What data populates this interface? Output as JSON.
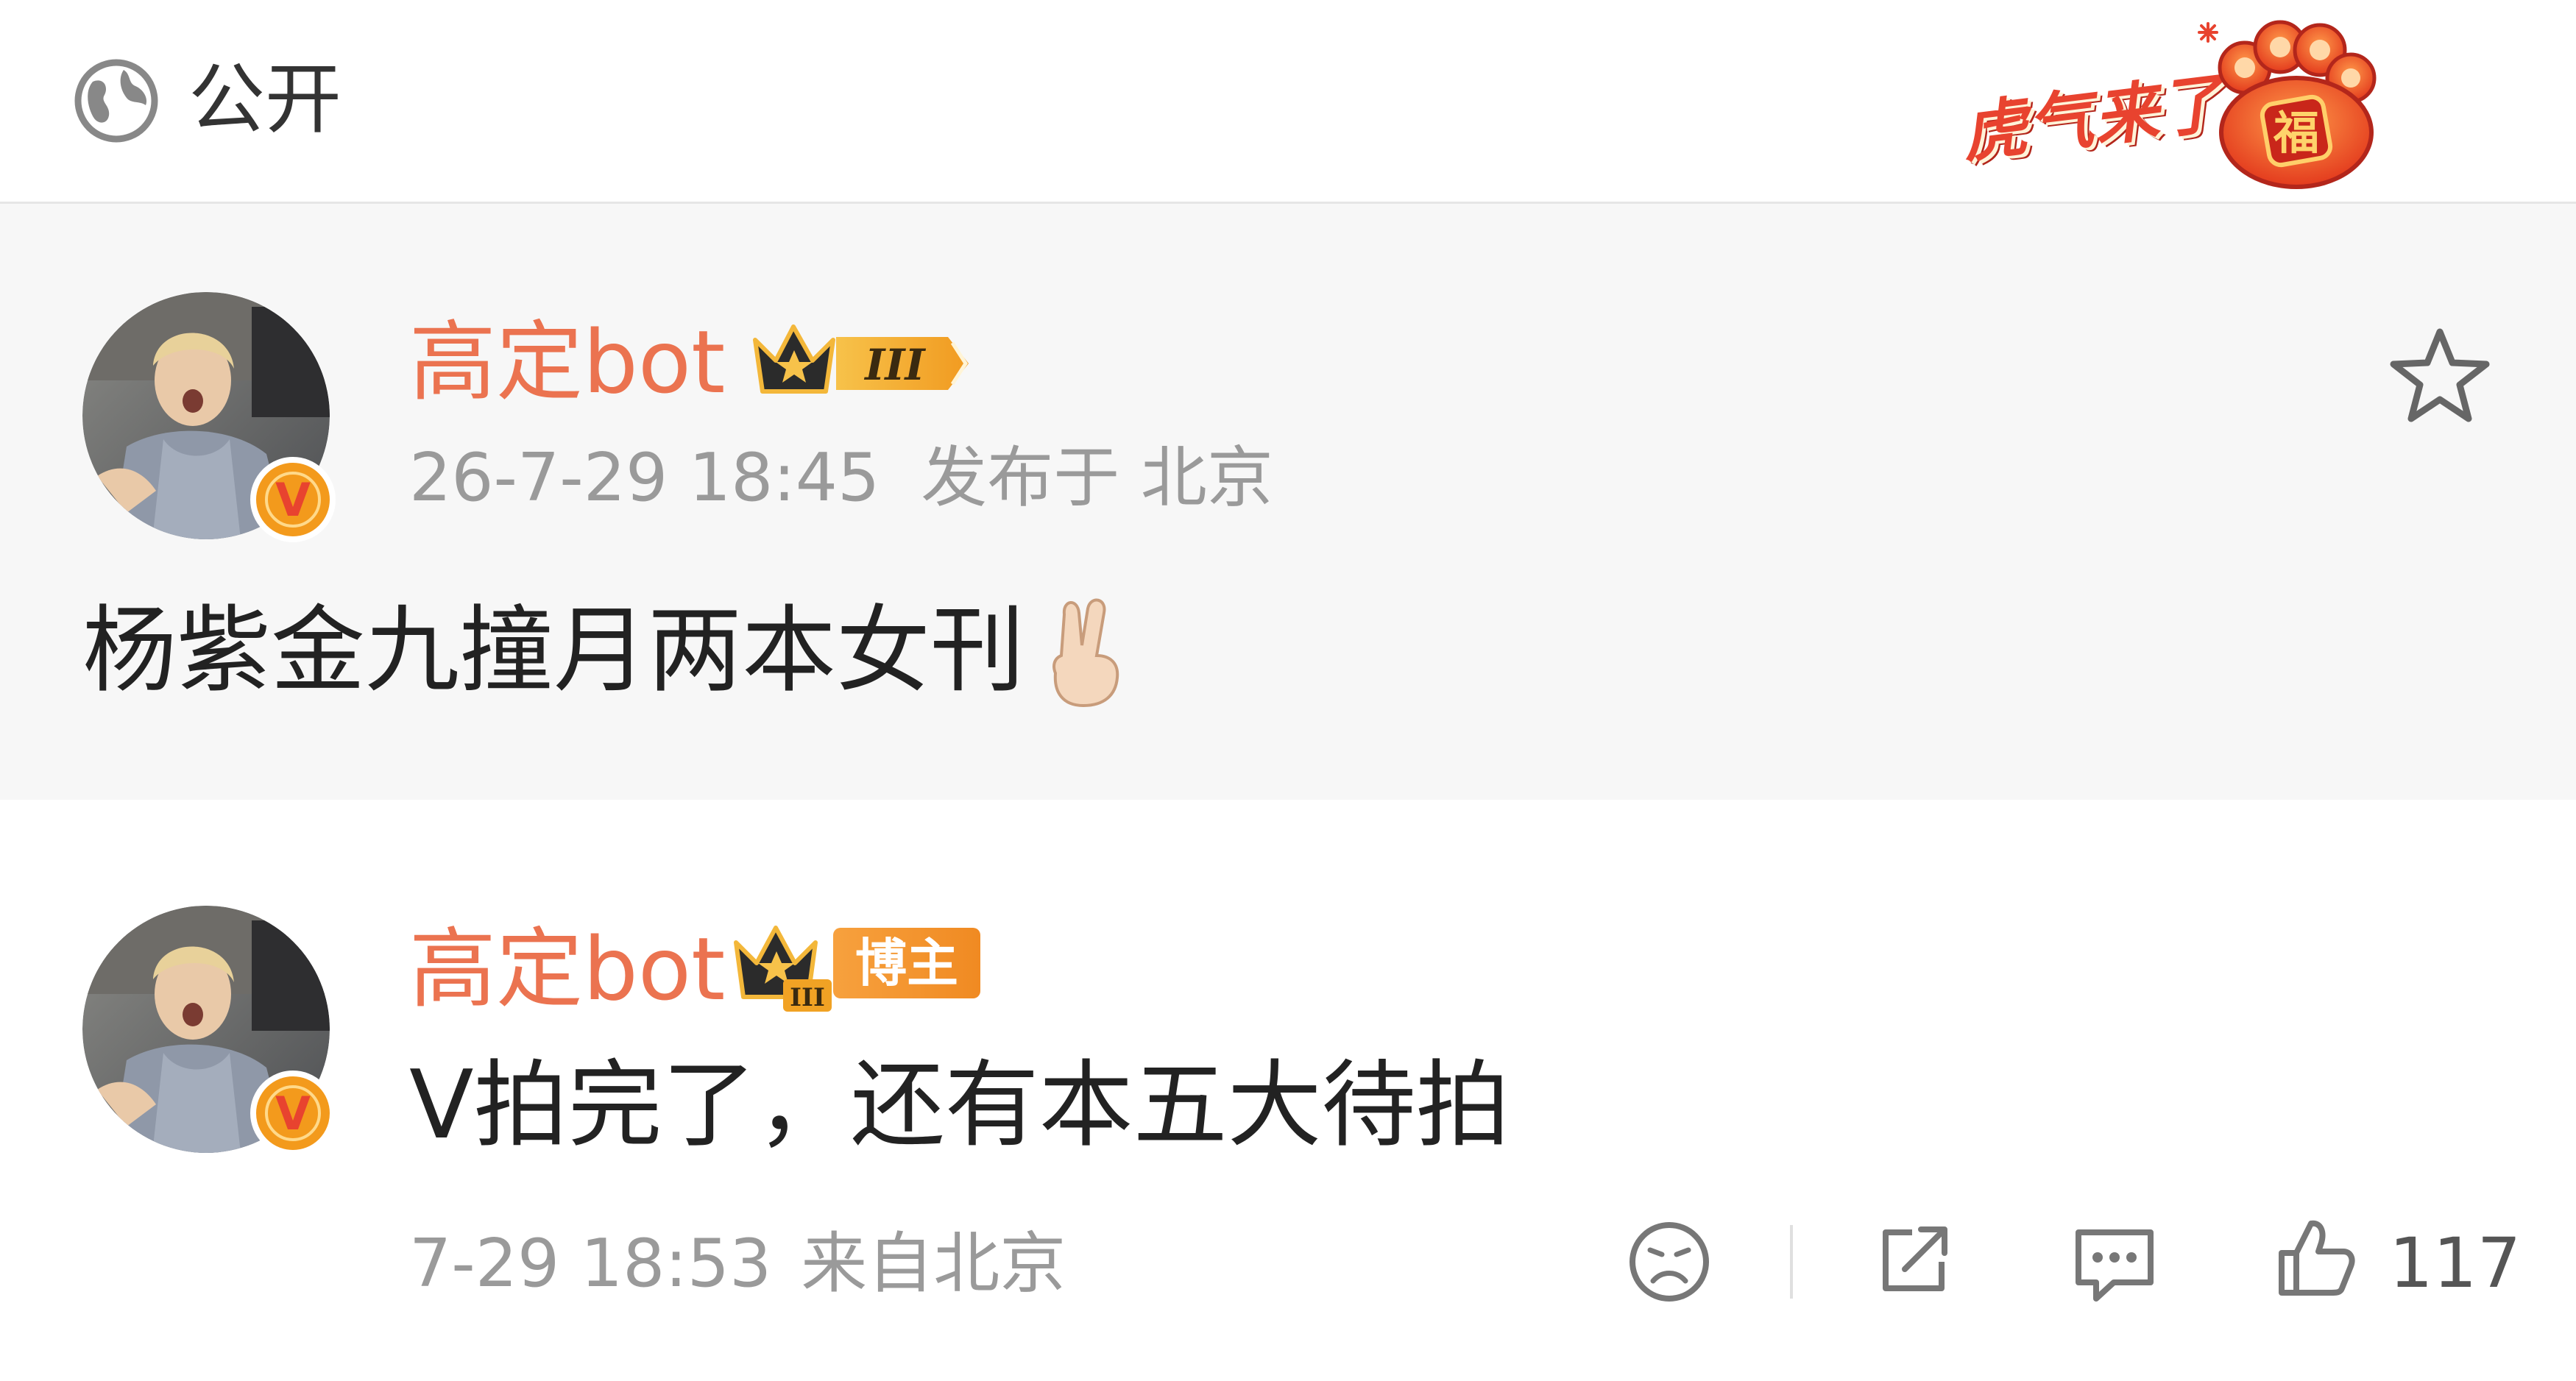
{
  "header": {
    "visibility_label": "公开",
    "visibility_icon": "globe-icon",
    "festive_banner_text": "虎气来了",
    "festive_paw_char": "福"
  },
  "post": {
    "username": "高定bot",
    "user_level": "III",
    "timestamp": "26-7-29 18:45",
    "location": "发布于 北京",
    "text": "杨紫金九撞月两本女刊",
    "emoji": "✌",
    "favorite_icon": "star-icon",
    "verified_mark": "V"
  },
  "comment": {
    "username": "高定bot",
    "user_level": "III",
    "role_badge": "博主",
    "text": "V拍完了，还有本五大待拍",
    "timestamp": "7-29 18:53",
    "location": "来自北京",
    "verified_mark": "V",
    "actions": {
      "reaction_icon": "sad-face-icon",
      "share_icon": "share-icon",
      "comment_icon": "comment-bubble-icon",
      "like_icon": "thumbs-up-icon",
      "like_count": "117"
    }
  },
  "colors": {
    "username": "#eb7350",
    "meta_text": "#9a9a9a",
    "badge_orange": "#f08a22",
    "verified_orange": "#f39a1c"
  }
}
